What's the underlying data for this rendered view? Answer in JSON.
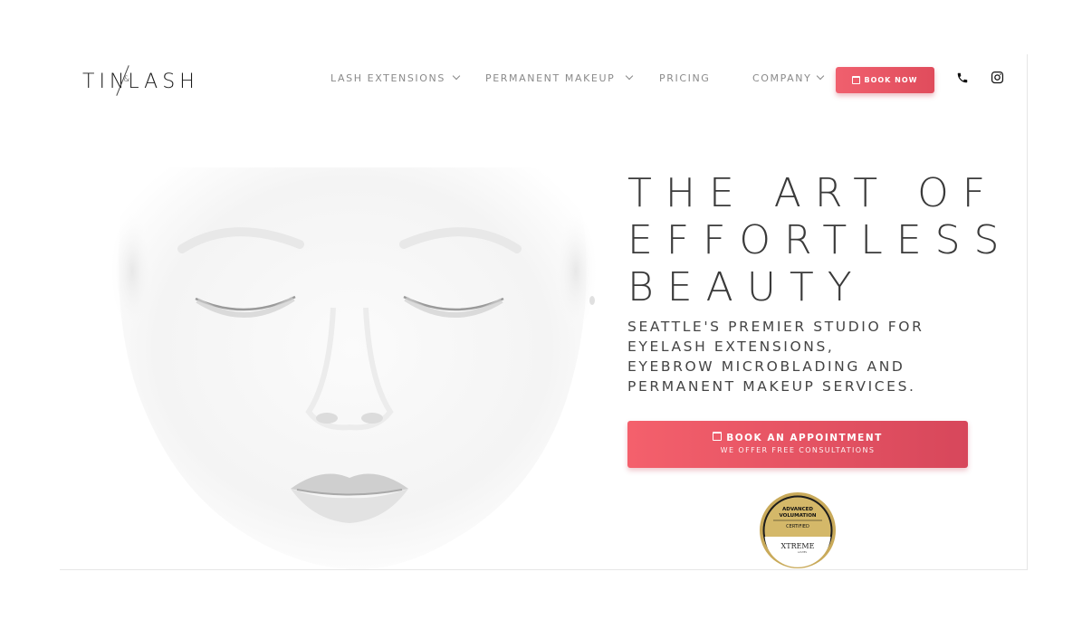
{
  "logo": {
    "left": "TIN",
    "amp": "&",
    "right": "LASH"
  },
  "nav": {
    "items": [
      {
        "label": "LASH EXTENSIONS",
        "has_dropdown": true
      },
      {
        "label": "PERMANENT MAKEUP",
        "has_dropdown": true
      },
      {
        "label": "PRICING",
        "has_dropdown": false
      },
      {
        "label": "COMPANY",
        "has_dropdown": true
      }
    ],
    "book_now": "BOOK NOW",
    "phone_icon": "phone-icon",
    "social_icon": "instagram-icon"
  },
  "hero": {
    "headline": [
      "THE ART OF",
      "EFFORTLESS",
      "BEAUTY"
    ],
    "subheadline": "SEATTLE'S PREMIER STUDIO FOR EYELASH EXTENSIONS, EYEBROW MICROBLADING AND PERMANENT MAKEUP SERVICES.",
    "cta": {
      "label": "BOOK AN APPOINTMENT",
      "sublabel": "WE OFFER FREE CONSULTATIONS"
    },
    "badge": {
      "line1": "ADVANCED",
      "line2": "VOLUMATION",
      "line3": "CERTIFIED",
      "brand": "XTREME",
      "brand_sub": "LASHES"
    }
  },
  "colors": {
    "accent": "#f0606e",
    "accent_dark": "#d7475b",
    "badge_gold": "#c9aa5a"
  }
}
